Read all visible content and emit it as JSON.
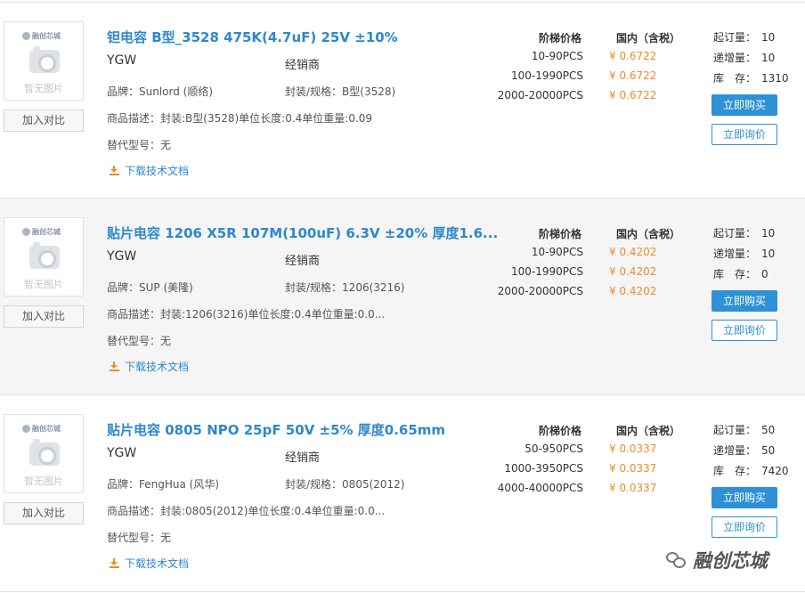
{
  "common": {
    "logo_text": "融创芯城",
    "no_image": "暂无图片",
    "compare_label": "加入对比",
    "download_label": "下载技术文档",
    "tier_header": "阶梯价格",
    "domestic_header": "国内（含税）",
    "moq_label": "起订量：",
    "increment_label": "递增量：",
    "stock_label": "库　存：",
    "buy_label": "立即购买",
    "inquire_label": "立即询价"
  },
  "products": [
    {
      "title": "钽电容 B型_3528 475K(4.7uF) 25V ±10%",
      "manufacturer": "YGW",
      "distributor": "经销商",
      "brand": "品牌：Sunlord (顺络)",
      "package": "封装/规格：B型(3528)",
      "description": "商品描述：封装:B型(3528)单位长度:0.4单位重量:0.09",
      "alternative": "替代型号：无",
      "tiers": [
        {
          "qty": "10-90PCS",
          "price": "¥ 0.6722"
        },
        {
          "qty": "100-1990PCS",
          "price": "¥ 0.6722"
        },
        {
          "qty": "2000-20000PCS",
          "price": "¥ 0.6722"
        }
      ],
      "moq": "10",
      "increment": "10",
      "stock": "1310"
    },
    {
      "title": "贴片电容 1206 X5R 107M(100uF) 6.3V ±20% 厚度1.6...",
      "manufacturer": "YGW",
      "distributor": "经销商",
      "brand": "品牌：SUP (美隆)",
      "package": "封装/规格：1206(3216)",
      "description": "商品描述：封装:1206(3216)单位长度:0.4单位重量:0.0...",
      "alternative": "替代型号：无",
      "tiers": [
        {
          "qty": "10-90PCS",
          "price": "¥ 0.4202"
        },
        {
          "qty": "100-1990PCS",
          "price": "¥ 0.4202"
        },
        {
          "qty": "2000-20000PCS",
          "price": "¥ 0.4202"
        }
      ],
      "moq": "10",
      "increment": "10",
      "stock": "0"
    },
    {
      "title": "贴片电容 0805 NPO 25pF 50V ±5% 厚度0.65mm",
      "manufacturer": "YGW",
      "distributor": "经销商",
      "brand": "品牌：FengHua (风华)",
      "package": "封装/规格：0805(2012)",
      "description": "商品描述：封装:0805(2012)单位长度:0.4单位重量:0.0...",
      "alternative": "替代型号：无",
      "tiers": [
        {
          "qty": "50-950PCS",
          "price": "¥ 0.0337"
        },
        {
          "qty": "1000-3950PCS",
          "price": "¥ 0.0337"
        },
        {
          "qty": "4000-40000PCS",
          "price": "¥ 0.0337"
        }
      ],
      "moq": "50",
      "increment": "50",
      "stock": "7420"
    }
  ],
  "watermark": {
    "text": "融创芯城",
    "icon": "wechat-icon"
  }
}
